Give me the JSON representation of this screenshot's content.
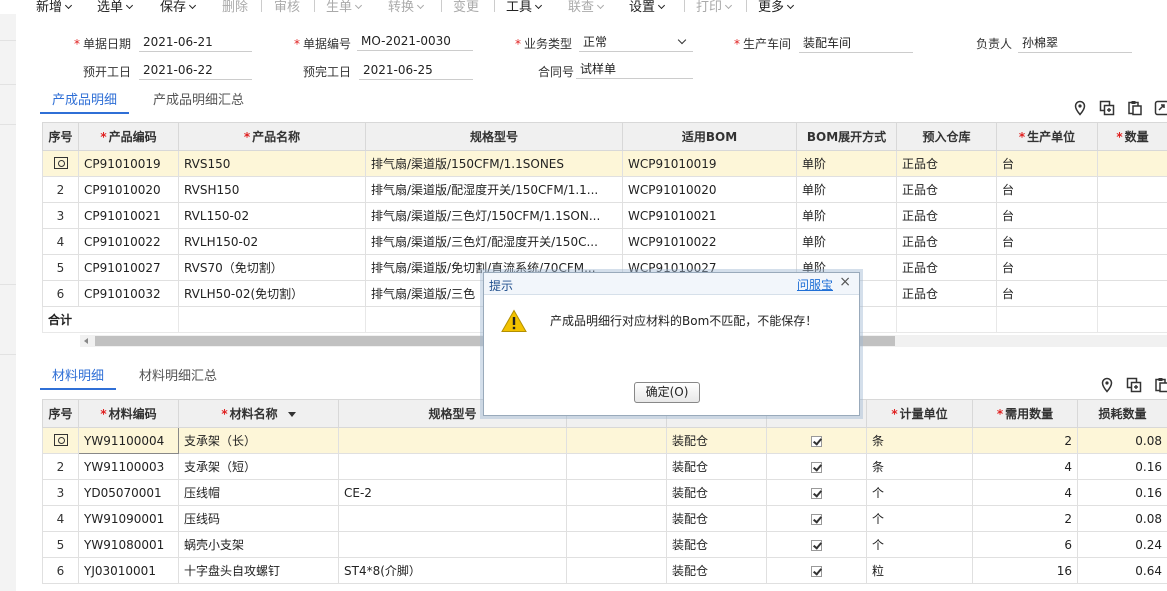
{
  "toolbar": {
    "items": [
      {
        "label": "新增",
        "disabled": false
      },
      {
        "label": "选单",
        "disabled": false
      },
      {
        "label": "保存",
        "disabled": false
      },
      {
        "label": "删除",
        "disabled": true
      },
      {
        "label": "审核",
        "disabled": true
      },
      {
        "label": "生单",
        "disabled": true
      },
      {
        "label": "转换",
        "disabled": true
      },
      {
        "label": "变更",
        "disabled": true
      },
      {
        "label": "工具",
        "disabled": false
      },
      {
        "label": "联查",
        "disabled": true
      },
      {
        "label": "设置",
        "disabled": false
      },
      {
        "label": "打印",
        "disabled": true
      },
      {
        "label": "更多",
        "disabled": false
      }
    ]
  },
  "form": {
    "doc_date_label": "单据日期",
    "doc_date": "2021-06-21",
    "doc_no_label": "单据编号",
    "doc_no": "MO-2021-0030",
    "biz_type_label": "业务类型",
    "biz_type": "正常",
    "workshop_label": "生产车间",
    "workshop": "装配车间",
    "owner_label": "负责人",
    "owner": "孙棉翠",
    "plan_start_label": "预开工日",
    "plan_start": "2021-06-22",
    "plan_end_label": "预完工日",
    "plan_end": "2021-06-25",
    "contract_label": "合同号",
    "contract": "试样单"
  },
  "product_tabs": {
    "active": "产成品明细",
    "other": "产成品明细汇总"
  },
  "product_table": {
    "headers": {
      "seq": "序号",
      "code": "产品编码",
      "name": "产品名称",
      "spec": "规格型号",
      "bom": "适用BOM",
      "bom_mode": "BOM展开方式",
      "warehouse": "预入仓库",
      "unit": "生产单位",
      "qty": "数量"
    },
    "rows": [
      {
        "seq": "",
        "code": "CP91010019",
        "name": "RVS150",
        "spec": "排气扇/渠道版/150CFM/1.1SONES",
        "bom": "WCP91010019",
        "bom_mode": "单阶",
        "warehouse": "正品仓",
        "unit": "台"
      },
      {
        "seq": "2",
        "code": "CP91010020",
        "name": "RVSH150",
        "spec": "排气扇/渠道版/配湿度开关/150CFM/1.1...",
        "bom": "WCP91010020",
        "bom_mode": "单阶",
        "warehouse": "正品仓",
        "unit": "台"
      },
      {
        "seq": "3",
        "code": "CP91010021",
        "name": "RVL150-02",
        "spec": "排气扇/渠道版/三色灯/150CFM/1.1SON...",
        "bom": "WCP91010021",
        "bom_mode": "单阶",
        "warehouse": "正品仓",
        "unit": "台"
      },
      {
        "seq": "4",
        "code": "CP91010022",
        "name": "RVLH150-02",
        "spec": "排气扇/渠道版/三色灯/配湿度开关/150C...",
        "bom": "WCP91010022",
        "bom_mode": "单阶",
        "warehouse": "正品仓",
        "unit": "台"
      },
      {
        "seq": "5",
        "code": "CP91010027",
        "name": "RVS70（免切割）",
        "spec": "排气扇/渠道版/免切割/直流系统/70CFM...",
        "bom": "WCP91010027",
        "bom_mode": "单阶",
        "warehouse": "正品仓",
        "unit": "台"
      },
      {
        "seq": "6",
        "code": "CP91010032",
        "name": "RVLH50-02(免切割）",
        "spec": "排气扇/渠道版/三色",
        "bom": "",
        "bom_mode": "",
        "warehouse": "正品仓",
        "unit": "台"
      }
    ],
    "total_label": "合计"
  },
  "material_tabs": {
    "active": "材料明细",
    "other": "材料明细汇总"
  },
  "material_table": {
    "headers": {
      "seq": "序号",
      "code": "材料编码",
      "name": "材料名称",
      "spec": "规格型号",
      "unit": "计量单位",
      "need": "需用数量",
      "loss": "损耗数量"
    },
    "rows": [
      {
        "seq": "",
        "code": "YW91100004",
        "name": "支承架（长）",
        "spec": "",
        "warehouse": "装配仓",
        "unit": "条",
        "need": "2",
        "loss": "0.08"
      },
      {
        "seq": "2",
        "code": "YW91100003",
        "name": "支承架（短）",
        "spec": "",
        "warehouse": "装配仓",
        "unit": "条",
        "need": "4",
        "loss": "0.16"
      },
      {
        "seq": "3",
        "code": "YD05070001",
        "name": "压线帽",
        "spec": "CE-2",
        "warehouse": "装配仓",
        "unit": "个",
        "need": "4",
        "loss": "0.16"
      },
      {
        "seq": "4",
        "code": "YW91090001",
        "name": "压线码",
        "spec": "",
        "warehouse": "装配仓",
        "unit": "个",
        "need": "2",
        "loss": "0.08"
      },
      {
        "seq": "5",
        "code": "YW91080001",
        "name": "蜗壳小支架",
        "spec": "",
        "warehouse": "装配仓",
        "unit": "个",
        "need": "6",
        "loss": "0.24"
      },
      {
        "seq": "6",
        "code": "YJ03010001",
        "name": "十字盘头自攻螺钉",
        "spec": "ST4*8(介脚）",
        "warehouse": "装配仓",
        "unit": "粒",
        "need": "16",
        "loss": "0.64"
      }
    ]
  },
  "dialog": {
    "title": "提示",
    "help_link": "问服宝",
    "close": "×",
    "message": "产成品明细行对应材料的Bom不匹配，不能保存！",
    "ok_label": "确定(O)"
  },
  "icons": {
    "location": "location-icon",
    "copy": "copy-icon",
    "paste": "paste-icon",
    "export": "export-icon",
    "warning": "warning-icon"
  },
  "colors": {
    "accent": "#2f6fd6",
    "required": "#e02020",
    "selected_row": "#fdf6d8",
    "warning": "#f2c200"
  }
}
